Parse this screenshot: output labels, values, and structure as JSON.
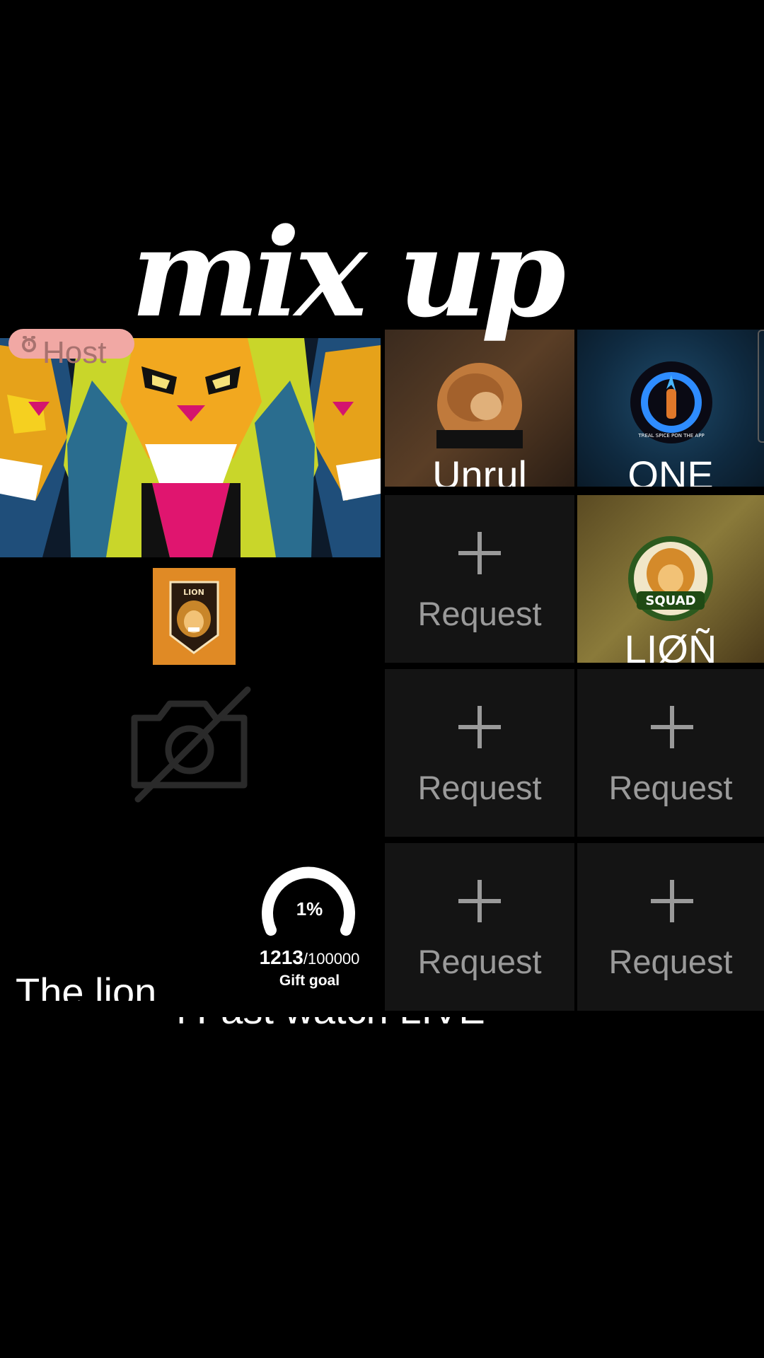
{
  "overlay": {
    "title": "mix up"
  },
  "host": {
    "badge_label": "Host",
    "badge_icon": "alarm-clock-icon",
    "name": "The lion",
    "camera_icon": "camera-off-icon"
  },
  "gift_goal": {
    "percent_text": "1%",
    "percent": 1,
    "current": "1213",
    "total": "/100000",
    "label": "Gift goal"
  },
  "bottom_caption": "l Fast watch LIVE",
  "guests": [
    {
      "name": "Unrul",
      "avatar": "lion-photo"
    },
    {
      "name": "ONE",
      "avatar": "flame-ring-logo",
      "logo_text": "TREAL SPICE PON THE APP"
    },
    {
      "name": "LIØÑ",
      "avatar": "lion-squad-logo",
      "logo_text": "SQUAD"
    }
  ],
  "request_label": "Request",
  "host_avatar_text": "LION",
  "colors": {
    "background": "#000000",
    "slot": "#141414",
    "badge": "#f1a8a4",
    "avatar_orange": "#e08a25"
  }
}
